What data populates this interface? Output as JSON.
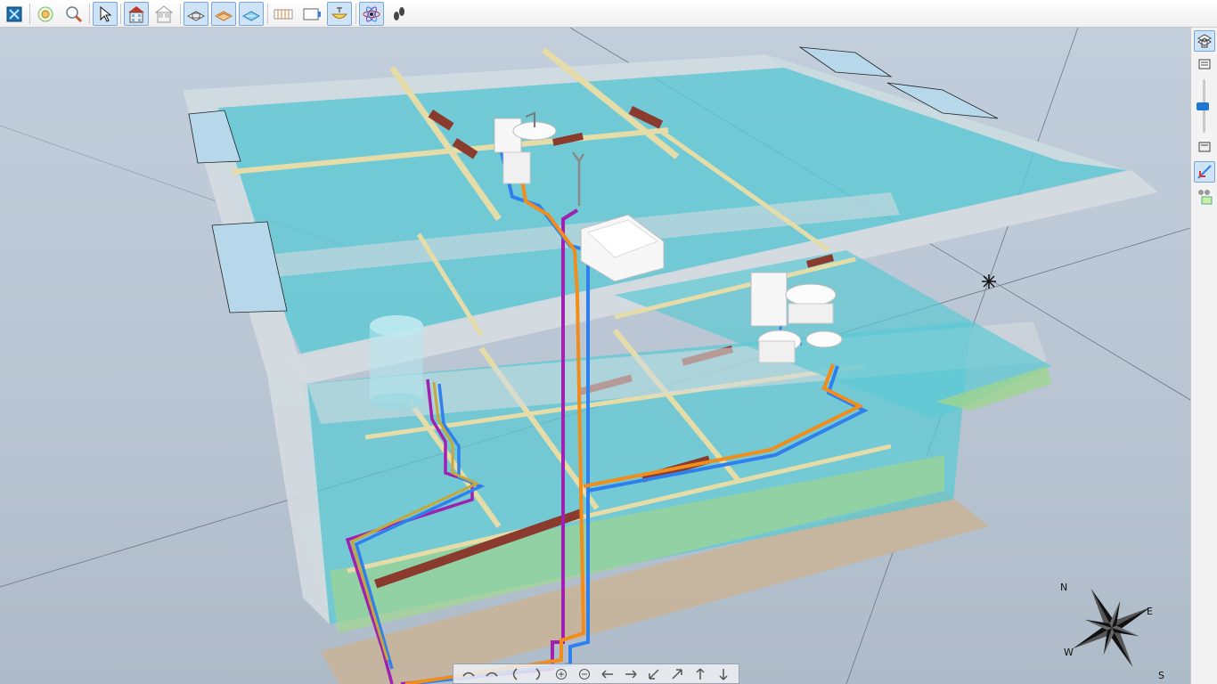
{
  "toolbar": {
    "buttons": [
      {
        "id": "app-menu",
        "icon": "app-logo-icon"
      },
      {
        "id": "zoom-fit",
        "icon": "zoom-fit-icon"
      },
      {
        "id": "zoom-window",
        "icon": "zoom-window-icon"
      },
      {
        "id": "select",
        "icon": "cursor-arrow-icon",
        "active": true
      },
      {
        "id": "building-view",
        "icon": "building-icon",
        "active": true
      },
      {
        "id": "building-wire",
        "icon": "building-wireframe-icon"
      },
      {
        "id": "floor-view",
        "icon": "floor-icon",
        "active": true
      },
      {
        "id": "slab-view",
        "icon": "slab-icon",
        "active": true
      },
      {
        "id": "ceiling-view",
        "icon": "ceiling-icon",
        "active": true
      },
      {
        "id": "radiator",
        "icon": "radiator-icon"
      },
      {
        "id": "boiler",
        "icon": "boiler-icon"
      },
      {
        "id": "sanitary",
        "icon": "washbasin-icon",
        "active": true
      },
      {
        "id": "atom",
        "icon": "atom-icon",
        "active": true
      },
      {
        "id": "walk",
        "icon": "footsteps-icon"
      }
    ]
  },
  "right_panel": {
    "buttons": [
      "floors-all-icon",
      "floors-single-icon",
      "floors-stack-icon",
      "section-cut-icon",
      "display-options-icon"
    ],
    "zoom_level": 0.5
  },
  "navigation": {
    "buttons": [
      "orbit-left-icon",
      "orbit-right-icon",
      "tilt-up-icon",
      "tilt-down-icon",
      "zoom-in-icon",
      "zoom-out-icon",
      "pan-left-icon",
      "pan-right-icon",
      "pan-down-left-icon",
      "pan-up-right-icon",
      "pan-up-icon",
      "pan-down-icon"
    ]
  },
  "compass": {
    "labels": {
      "north": "N",
      "east": "E",
      "south": "S",
      "west": "W"
    }
  },
  "colors": {
    "cold_water": "#2f80ed",
    "hot_water": "#f28c1b",
    "circulation": "#a020b0",
    "floor_glass": "#5cc9d4",
    "wall": "#d4dbe0",
    "beam": "#e6dca8",
    "door": "#8b3a2e"
  }
}
